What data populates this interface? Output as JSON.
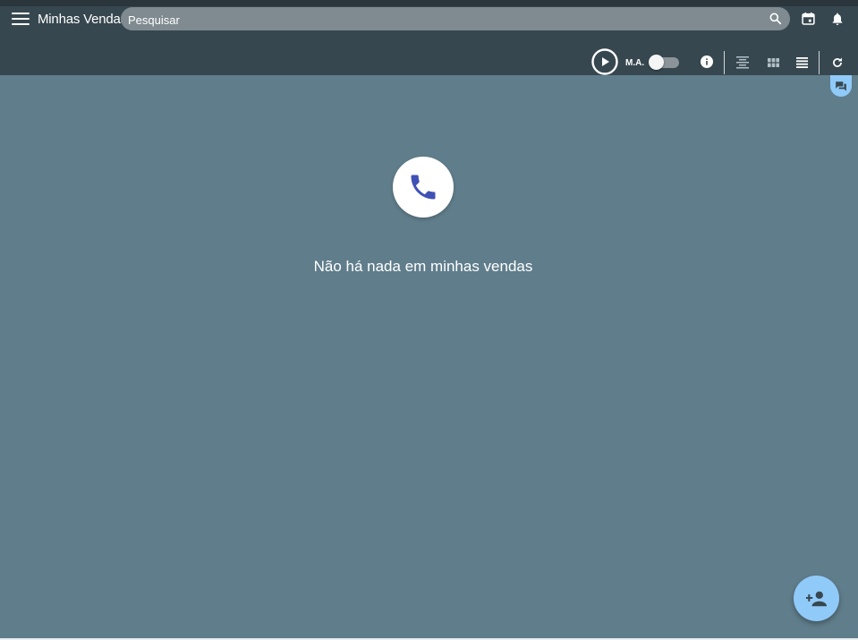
{
  "header": {
    "title": "Minhas Vendas",
    "search_placeholder": "Pesquisar",
    "menu_icon": "menu-icon",
    "calendar_icon": "calendar-icon",
    "bell_icon": "bell-icon"
  },
  "toolbar": {
    "play_icon": "play-circle-icon",
    "ma_label": "M.A.",
    "ma_toggle_on": false,
    "info_icon": "info-icon",
    "align_center_icon": "align-center-icon",
    "grid_icon": "grid-icon",
    "list_icon": "list-icon",
    "refresh_icon": "refresh-icon"
  },
  "main": {
    "empty_icon": "phone-icon",
    "empty_message": "Não há nada em minhas vendas"
  },
  "chat_tab_icon": "chat-icon",
  "fab_icon": "person-add-icon",
  "colors": {
    "background": "#607d8b",
    "topbar": "#37474f",
    "accent": "#90caf9",
    "phone_icon": "#3f51b5"
  }
}
